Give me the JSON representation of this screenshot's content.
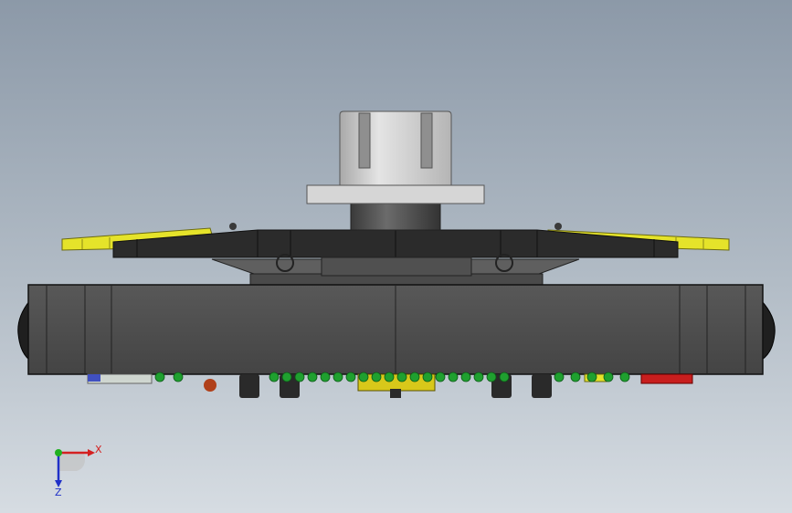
{
  "viewport": {
    "background_top": "#8c99a8",
    "background_bottom": "#d6dce2"
  },
  "colors": {
    "body": "#4c4c4c",
    "plate": "#2b2b2b",
    "plate_wing": "#e5e32a",
    "bracket": "#5a5a5a",
    "spindle": "#c9c9c9",
    "collar": "#d9d9d9",
    "wheel": "#1f1f1f",
    "bead_green": "#1fa02f",
    "bead_yellow": "#d8c81a",
    "bead_red": "#c81e1e",
    "axis_x": "#d42020",
    "axis_y": "#20b020",
    "axis_z": "#2030c8"
  },
  "triad": {
    "x_label": "X",
    "z_label": "Z"
  }
}
